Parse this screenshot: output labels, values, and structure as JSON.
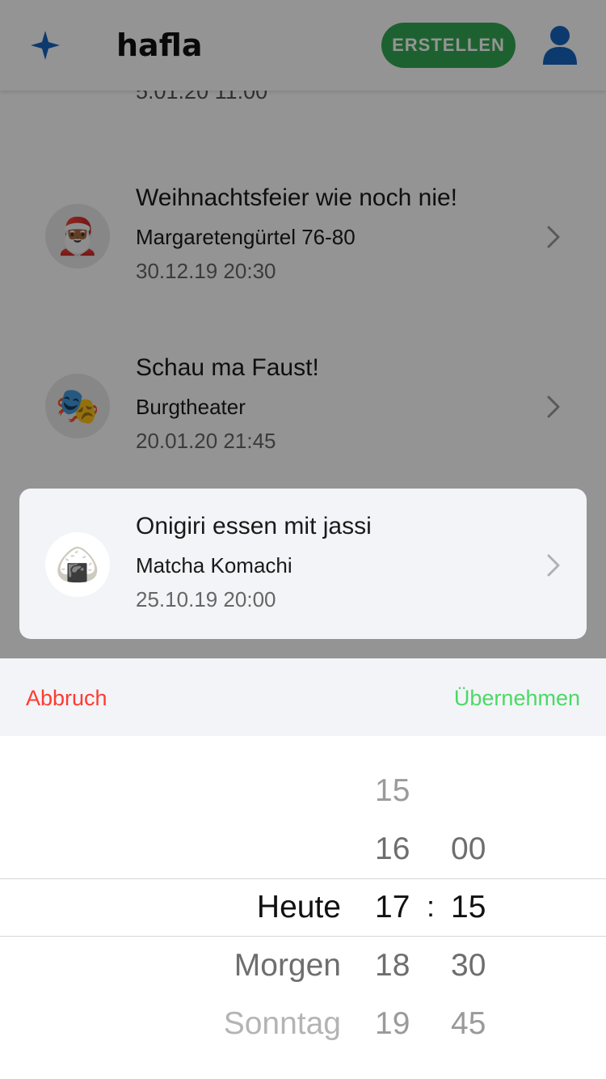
{
  "header": {
    "app_name": "hafla",
    "create_label": "ERSTELLEN",
    "logo_icon": "sparkle-icon",
    "user_icon": "user-icon",
    "accent_color": "#1565c0",
    "create_color": "#34a853"
  },
  "list": {
    "partial_date": "5.01.20 11:00",
    "events": [
      {
        "title": "Weihnachtsfeier wie noch nie!",
        "place": "Margaretengürtel 76-80",
        "date": "30.12.19 20:30",
        "icon": "santa-icon",
        "emoji": "🎅🏾"
      },
      {
        "title": "Schau ma Faust!",
        "place": "Burgtheater",
        "date": "20.01.20 21:45",
        "icon": "theater-masks-icon",
        "emoji": "🎭"
      },
      {
        "title": "Onigiri essen mit jassi",
        "place": "Matcha Komachi",
        "date": "25.10.19 20:00",
        "icon": "onigiri-icon",
        "emoji": "🍙"
      }
    ]
  },
  "picker_toolbar": {
    "cancel_label": "Abbruch",
    "apply_label": "Übernehmen",
    "cancel_color": "#ff3b30",
    "apply_color": "#4cd964"
  },
  "picker": {
    "days": [
      "Heute",
      "Morgen",
      "Sonntag"
    ],
    "hours": [
      "15",
      "16",
      "17",
      "18",
      "19"
    ],
    "minutes": [
      "00",
      "15",
      "30",
      "45"
    ],
    "separator": ":",
    "selected": {
      "day": "Heute",
      "hour": "17",
      "minute": "15"
    }
  }
}
